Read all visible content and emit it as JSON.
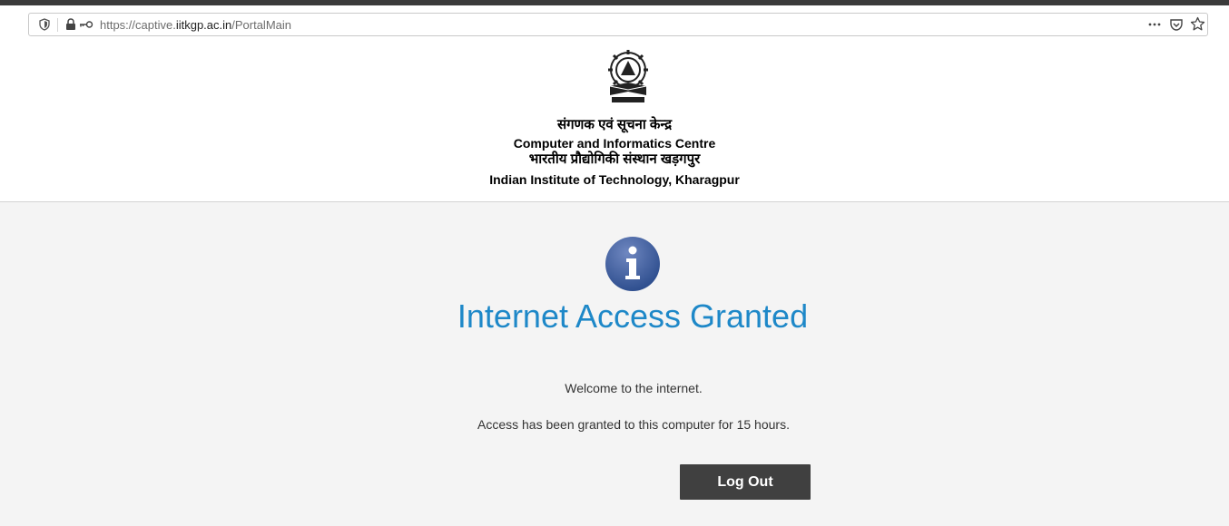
{
  "browser": {
    "url_prefix": "https://captive.",
    "url_host": "iitkgp.ac.in",
    "url_path": "/PortalMain"
  },
  "header": {
    "hindi_centre_name": "संगणक एवं सूचना केन्द्र",
    "english_centre_name": "Computer and Informatics Centre",
    "hindi_institute_name": "भारतीय प्रौद्योगिकी संस्थान खड़गपुर",
    "english_institute_name": "Indian Institute of Technology, Kharagpur"
  },
  "main": {
    "title": "Internet Access Granted",
    "welcome_text": "Welcome to the internet.",
    "access_text": "Access has been granted to this computer for 15 hours.",
    "logout_label": "Log Out"
  },
  "icons": [
    "shield-icon",
    "lock-icon",
    "key-icon",
    "more-icon",
    "pocket-icon",
    "star-icon",
    "institute-logo",
    "info-icon"
  ],
  "colors": {
    "title": "#1e88c8",
    "button": "#404040",
    "background": "#f4f4f4"
  }
}
